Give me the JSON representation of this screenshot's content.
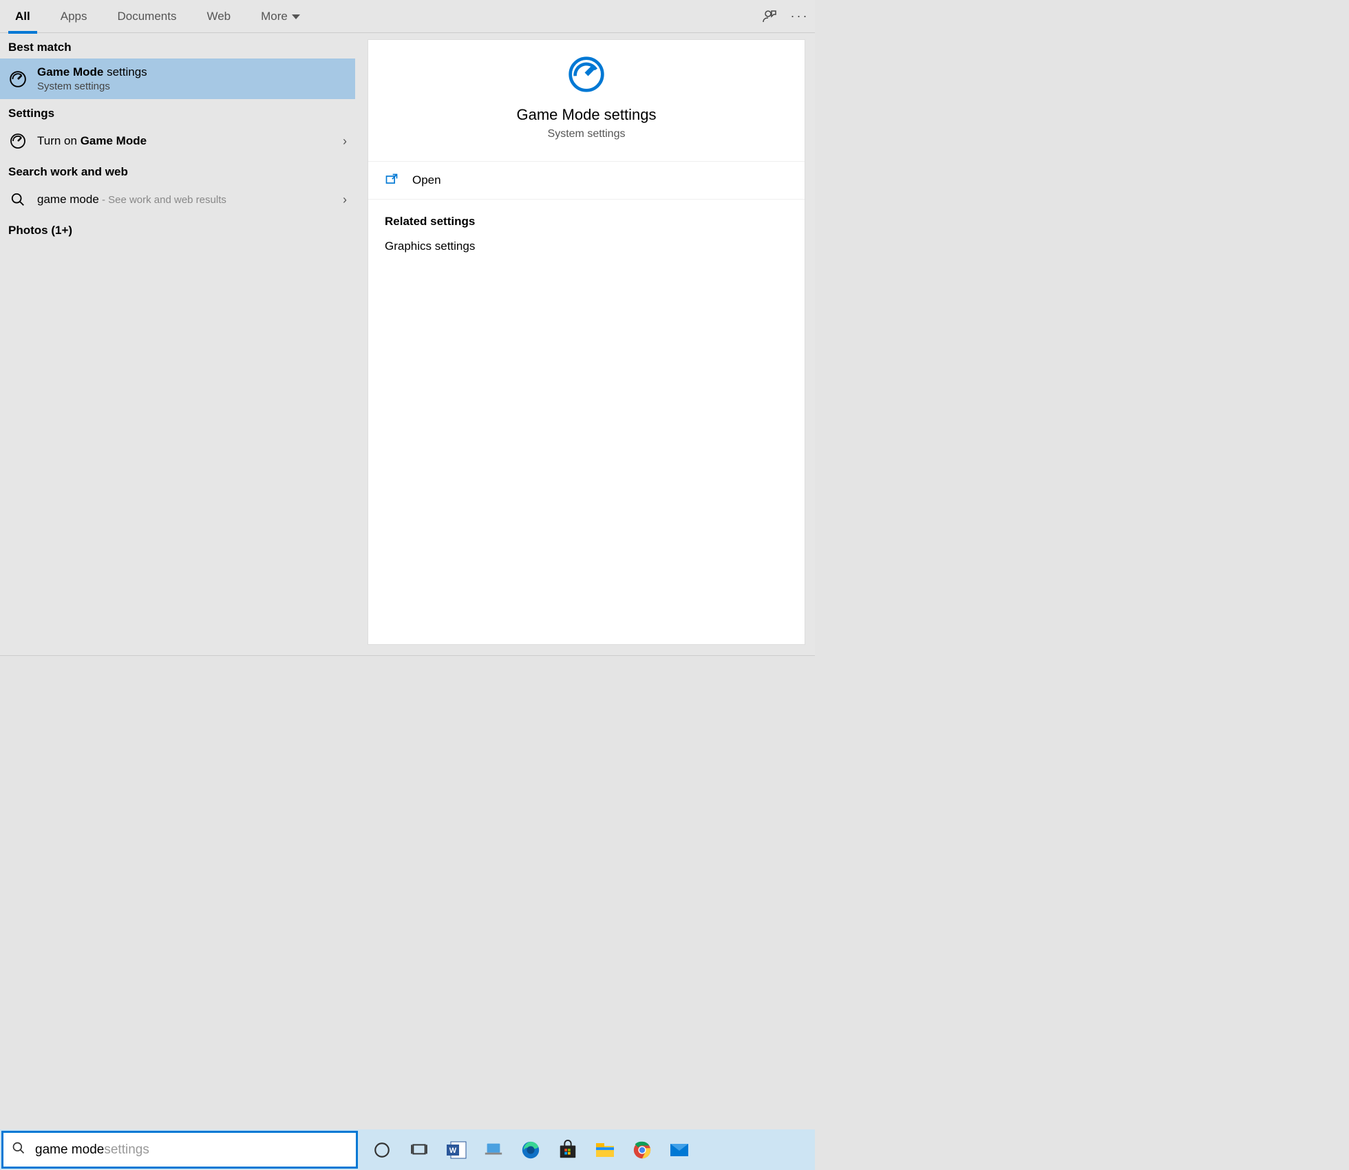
{
  "tabs": {
    "all": "All",
    "apps": "Apps",
    "documents": "Documents",
    "web": "Web",
    "more": "More"
  },
  "sections": {
    "best_match": "Best match",
    "settings": "Settings",
    "search_web": "Search work and web",
    "photos": "Photos (1+)"
  },
  "best": {
    "title_bold": "Game Mode",
    "title_rest": " settings",
    "sub": "System settings"
  },
  "settings_item": {
    "prefix": "Turn on ",
    "bold": "Game Mode"
  },
  "web_item": {
    "query": "game mode",
    "hint": " - See work and web results"
  },
  "preview": {
    "title": "Game Mode settings",
    "sub": "System settings",
    "open": "Open",
    "related_h": "Related settings",
    "related_1": "Graphics settings"
  },
  "search": {
    "typed": "game mode",
    "completion": " settings"
  }
}
